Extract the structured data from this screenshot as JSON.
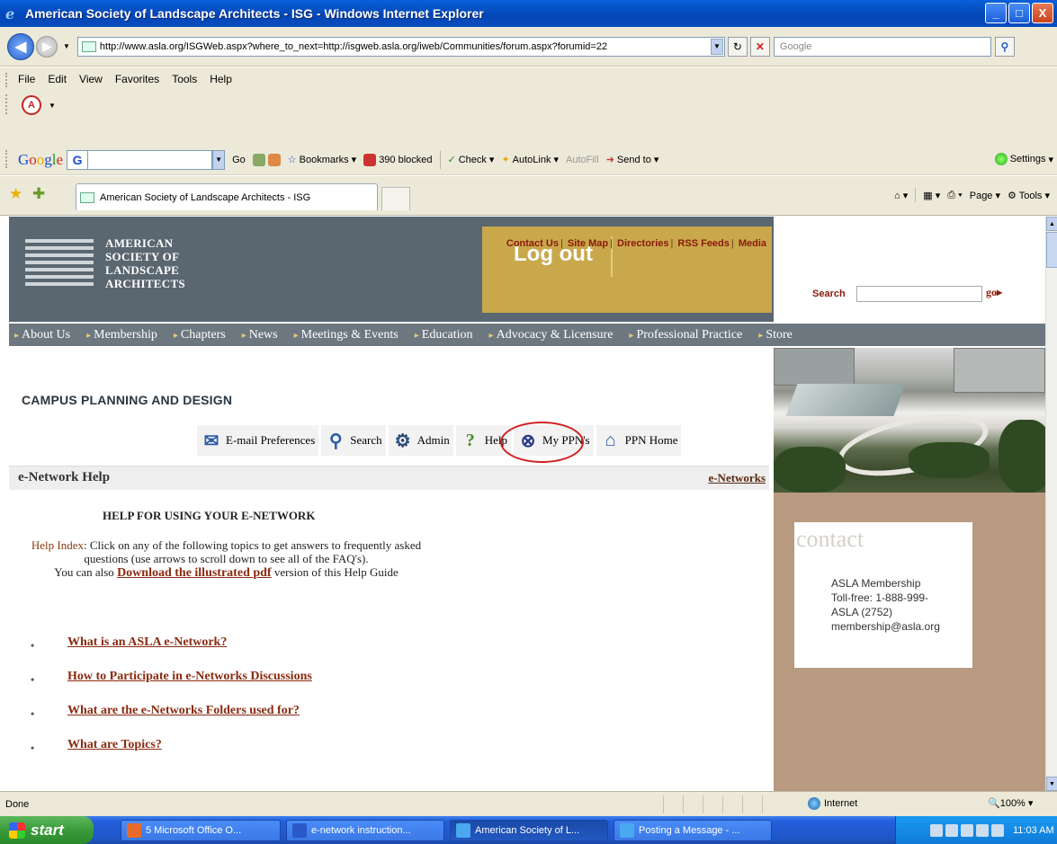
{
  "window": {
    "title": "American Society of Landscape Architects - ISG - Windows Internet Explorer",
    "buttons": [
      "_",
      "□",
      "X"
    ]
  },
  "address": {
    "url": "http://www.asla.org/ISGWeb.aspx?where_to_next=http://isgweb.asla.org/iweb/Communities/forum.aspx?forumid=22",
    "search_placeholder": "Google"
  },
  "menu": [
    "File",
    "Edit",
    "View",
    "Favorites",
    "Tools",
    "Help"
  ],
  "google_toolbar": {
    "logo": "Google",
    "go": "Go",
    "bookmarks": "Bookmarks",
    "blocked": "390 blocked",
    "check": "Check",
    "autolink": "AutoLink",
    "autofill": "AutoFill",
    "sendto": "Send to",
    "settings": "Settings"
  },
  "tabs": {
    "active": "American Society of Landscape Architects - ISG"
  },
  "command_bar": {
    "page": "Page",
    "tools": "Tools"
  },
  "site": {
    "org_name": [
      "AMERICAN",
      "SOCIETY OF",
      "LANDSCAPE",
      "ARCHITECTS"
    ],
    "logout": "Log out",
    "top_links": [
      "Contact Us",
      "Site Map",
      "Directories",
      "RSS Feeds",
      "Media"
    ],
    "search_label": "Search",
    "go": "go",
    "nav": [
      "About Us",
      "Membership",
      "Chapters",
      "News",
      "Meetings & Events",
      "Education",
      "Advocacy & Licensure",
      "Professional Practice",
      "Store"
    ],
    "section_title": "CAMPUS PLANNING AND DESIGN",
    "toolbar": [
      "E-mail Preferences",
      "Search",
      "Admin",
      "Help",
      "My PPN's",
      "PPN Home"
    ],
    "sub_title": "e-Network Help",
    "sub_link": "e-Networks",
    "help_heading": "HELP FOR USING YOUR E-NETWORK",
    "help_index_label": "Help Index",
    "help_text_1": ": Click on any of the following topics to get answers to frequently asked questions (use arrows to scroll down to see all of the FAQ's).",
    "help_text_2": "You can also ",
    "download_link": "Download the illustrated pdf",
    "help_text_3": " version of this Help Guide",
    "topics": [
      "What is an ASLA e-Network?",
      "How to Participate in e-Networks Discussions",
      "What are the e-Networks Folders used for?",
      "What are Topics?"
    ],
    "contact": {
      "title": "contact",
      "lines": [
        "ASLA Membership",
        "Toll-free: 1-888-999-",
        "ASLA (2752)",
        "membership@asla.org"
      ]
    }
  },
  "status": {
    "text": "Done",
    "zone": "Internet",
    "zoom": "100%"
  },
  "taskbar": {
    "start": "start",
    "tasks": [
      "5 Microsoft Office O...",
      "e-network instruction...",
      "American Society of L...",
      "Posting a Message - ..."
    ],
    "clock": "11:03 AM"
  }
}
